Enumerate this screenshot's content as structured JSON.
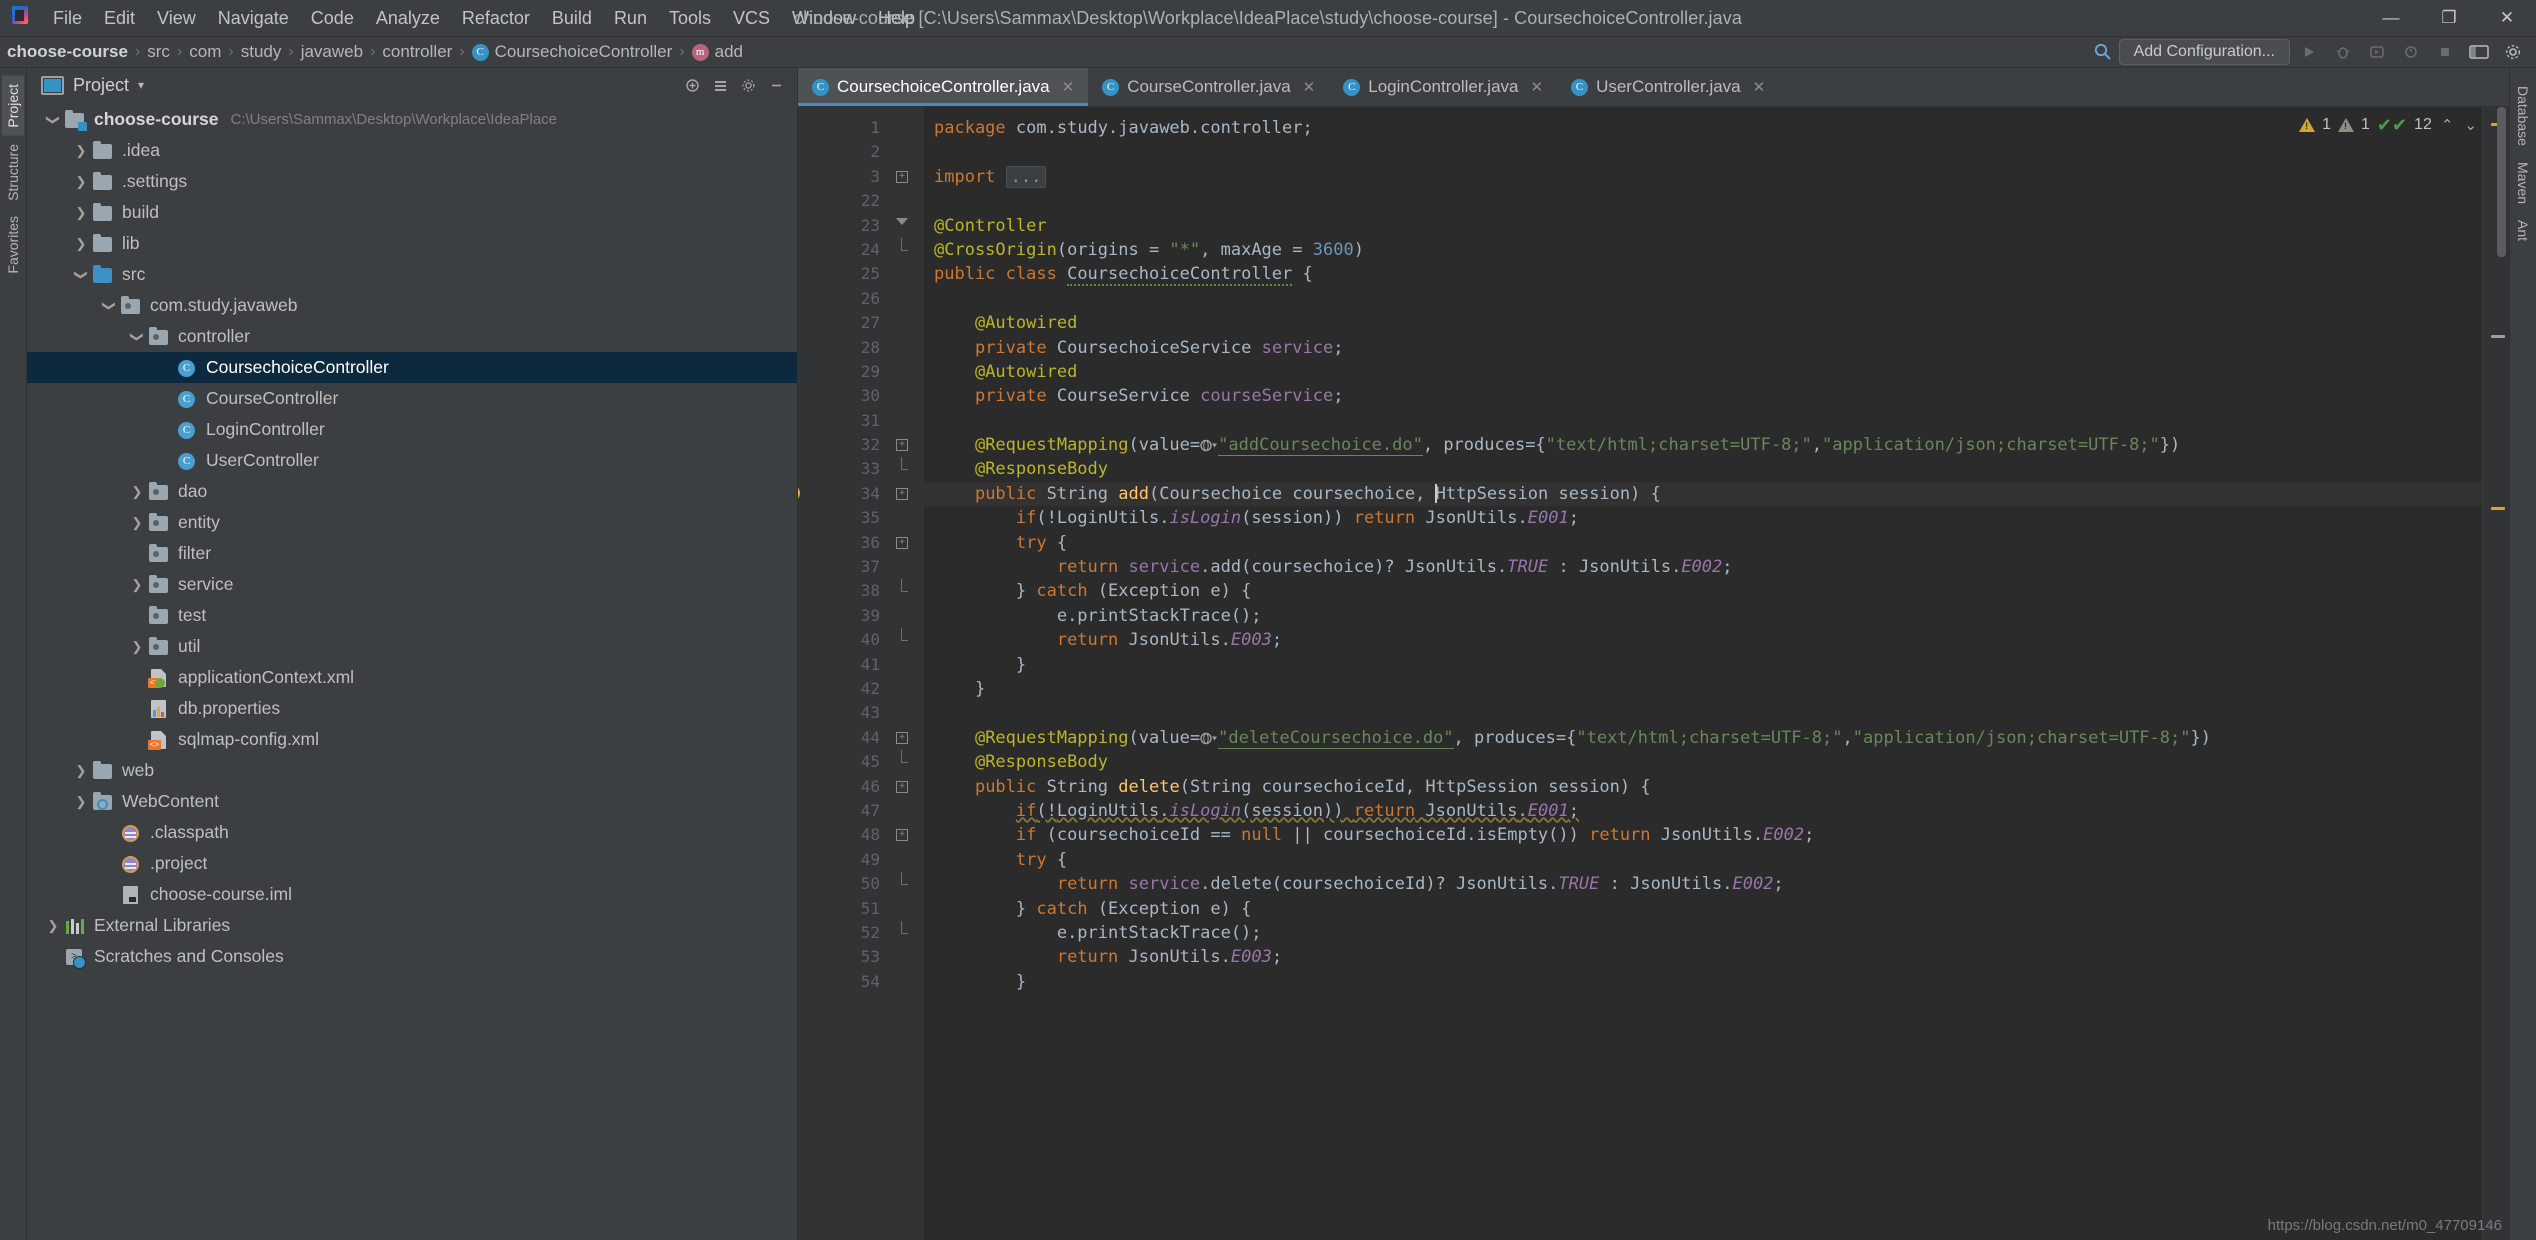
{
  "window": {
    "title": "choose-course [C:\\Users\\Sammax\\Desktop\\Workplace\\IdeaPlace\\study\\choose-course] - CoursechoiceController.java",
    "minimize": "—",
    "maximize": "❐",
    "close": "✕"
  },
  "menu": {
    "items": [
      {
        "label": "File"
      },
      {
        "label": "Edit"
      },
      {
        "label": "View"
      },
      {
        "label": "Navigate"
      },
      {
        "label": "Code"
      },
      {
        "label": "Analyze"
      },
      {
        "label": "Refactor"
      },
      {
        "label": "Build"
      },
      {
        "label": "Run"
      },
      {
        "label": "Tools"
      },
      {
        "label": "VCS"
      },
      {
        "label": "Window"
      },
      {
        "label": "Help"
      }
    ]
  },
  "navbar": {
    "breadcrumbs": [
      {
        "label": "choose-course",
        "icon": "none",
        "bold": true
      },
      {
        "label": "src",
        "icon": "none",
        "bold": false
      },
      {
        "label": "com",
        "icon": "none",
        "bold": false
      },
      {
        "label": "study",
        "icon": "none",
        "bold": false
      },
      {
        "label": "javaweb",
        "icon": "none",
        "bold": false
      },
      {
        "label": "controller",
        "icon": "none",
        "bold": false
      },
      {
        "label": "CoursechoiceController",
        "icon": "class-icon",
        "bold": false
      },
      {
        "label": "add",
        "icon": "method-icon",
        "bold": false
      }
    ],
    "separator": "›",
    "add_configuration": "Add Configuration...",
    "search_icon": "search-icon",
    "run_icon": "run-icon",
    "debug_icon": "debug-icon",
    "coverage_icon": "coverage-icon",
    "profile_icon": "profile-icon",
    "stop_icon": "stop-icon",
    "layout_icon": "layout-icon",
    "search_everywhere_icon": "search-everywhere-icon",
    "settings_icon": "settings-icon"
  },
  "sidebar": {
    "title": "Project",
    "caret": "▾",
    "header_buttons": [
      "collapse-all-icon",
      "expand-all-icon",
      "settings-icon",
      "hide-icon"
    ],
    "left_rail": [
      "Project",
      "Structure",
      "Favorites"
    ],
    "right_rail": [
      "Database",
      "Maven",
      "Ant"
    ],
    "tree": [
      {
        "label": "choose-course",
        "path": "C:\\Users\\Sammax\\Desktop\\Workplace\\IdeaPlace",
        "indent": 0,
        "arrow": "down",
        "icon": "module-folder",
        "bold": true,
        "selected": false
      },
      {
        "label": ".idea",
        "indent": 1,
        "arrow": "right",
        "icon": "folder",
        "bold": false,
        "selected": false
      },
      {
        "label": ".settings",
        "indent": 1,
        "arrow": "right",
        "icon": "folder",
        "bold": false,
        "selected": false
      },
      {
        "label": "build",
        "indent": 1,
        "arrow": "right",
        "icon": "folder",
        "bold": false,
        "selected": false
      },
      {
        "label": "lib",
        "indent": 1,
        "arrow": "right",
        "icon": "folder",
        "bold": false,
        "selected": false
      },
      {
        "label": "src",
        "indent": 1,
        "arrow": "down",
        "icon": "source-folder",
        "bold": false,
        "selected": false
      },
      {
        "label": "com.study.javaweb",
        "indent": 2,
        "arrow": "down",
        "icon": "package",
        "bold": false,
        "selected": false
      },
      {
        "label": "controller",
        "indent": 3,
        "arrow": "down",
        "icon": "package",
        "bold": false,
        "selected": false
      },
      {
        "label": "CoursechoiceController",
        "indent": 4,
        "arrow": "none",
        "icon": "class",
        "bold": false,
        "selected": true
      },
      {
        "label": "CourseController",
        "indent": 4,
        "arrow": "none",
        "icon": "class",
        "bold": false,
        "selected": false
      },
      {
        "label": "LoginController",
        "indent": 4,
        "arrow": "none",
        "icon": "class",
        "bold": false,
        "selected": false
      },
      {
        "label": "UserController",
        "indent": 4,
        "arrow": "none",
        "icon": "class",
        "bold": false,
        "selected": false
      },
      {
        "label": "dao",
        "indent": 3,
        "arrow": "right",
        "icon": "package",
        "bold": false,
        "selected": false
      },
      {
        "label": "entity",
        "indent": 3,
        "arrow": "right",
        "icon": "package",
        "bold": false,
        "selected": false
      },
      {
        "label": "filter",
        "indent": 3,
        "arrow": "none",
        "icon": "package",
        "bold": false,
        "selected": false
      },
      {
        "label": "service",
        "indent": 3,
        "arrow": "right",
        "icon": "package",
        "bold": false,
        "selected": false
      },
      {
        "label": "test",
        "indent": 3,
        "arrow": "none",
        "icon": "package",
        "bold": false,
        "selected": false
      },
      {
        "label": "util",
        "indent": 3,
        "arrow": "right",
        "icon": "package",
        "bold": false,
        "selected": false
      },
      {
        "label": "applicationContext.xml",
        "indent": 3,
        "arrow": "none",
        "icon": "xml-spring",
        "bold": false,
        "selected": false
      },
      {
        "label": "db.properties",
        "indent": 3,
        "arrow": "none",
        "icon": "properties",
        "bold": false,
        "selected": false
      },
      {
        "label": "sqlmap-config.xml",
        "indent": 3,
        "arrow": "none",
        "icon": "xml",
        "bold": false,
        "selected": false
      },
      {
        "label": "web",
        "indent": 1,
        "arrow": "right",
        "icon": "folder",
        "bold": false,
        "selected": false
      },
      {
        "label": "WebContent",
        "indent": 1,
        "arrow": "right",
        "icon": "web-folder",
        "bold": false,
        "selected": false
      },
      {
        "label": ".classpath",
        "indent": 2,
        "arrow": "none",
        "icon": "eclipse",
        "bold": false,
        "selected": false
      },
      {
        "label": ".project",
        "indent": 2,
        "arrow": "none",
        "icon": "eclipse",
        "bold": false,
        "selected": false
      },
      {
        "label": "choose-course.iml",
        "indent": 2,
        "arrow": "none",
        "icon": "iml",
        "bold": false,
        "selected": false
      },
      {
        "label": "External Libraries",
        "indent": 0,
        "arrow": "right",
        "icon": "libraries",
        "bold": false,
        "selected": false
      },
      {
        "label": "Scratches and Consoles",
        "indent": 0,
        "arrow": "none",
        "icon": "scratches",
        "bold": false,
        "selected": false
      }
    ]
  },
  "editor": {
    "tabs": [
      {
        "label": "CoursechoiceController.java",
        "active": true,
        "close": "✕"
      },
      {
        "label": "CourseController.java",
        "active": false,
        "close": "✕"
      },
      {
        "label": "LoginController.java",
        "active": false,
        "close": "✕"
      },
      {
        "label": "UserController.java",
        "active": false,
        "close": "✕"
      }
    ],
    "inspection": {
      "warnings_yellow": "1",
      "warnings_grey": "1",
      "typos_ok": "12",
      "check_glyph": "✔✔",
      "up_arrow": "⌃",
      "down_arrow": "⌄"
    },
    "line_numbers": [
      1,
      2,
      3,
      22,
      23,
      24,
      25,
      26,
      27,
      28,
      29,
      30,
      31,
      32,
      33,
      34,
      35,
      36,
      37,
      38,
      39,
      40,
      41,
      42,
      43,
      44,
      45,
      46,
      47,
      48,
      49,
      50,
      51,
      52,
      53,
      54
    ],
    "current_line_index": 15
  },
  "watermark": "https://blog.csdn.net/m0_47709146"
}
